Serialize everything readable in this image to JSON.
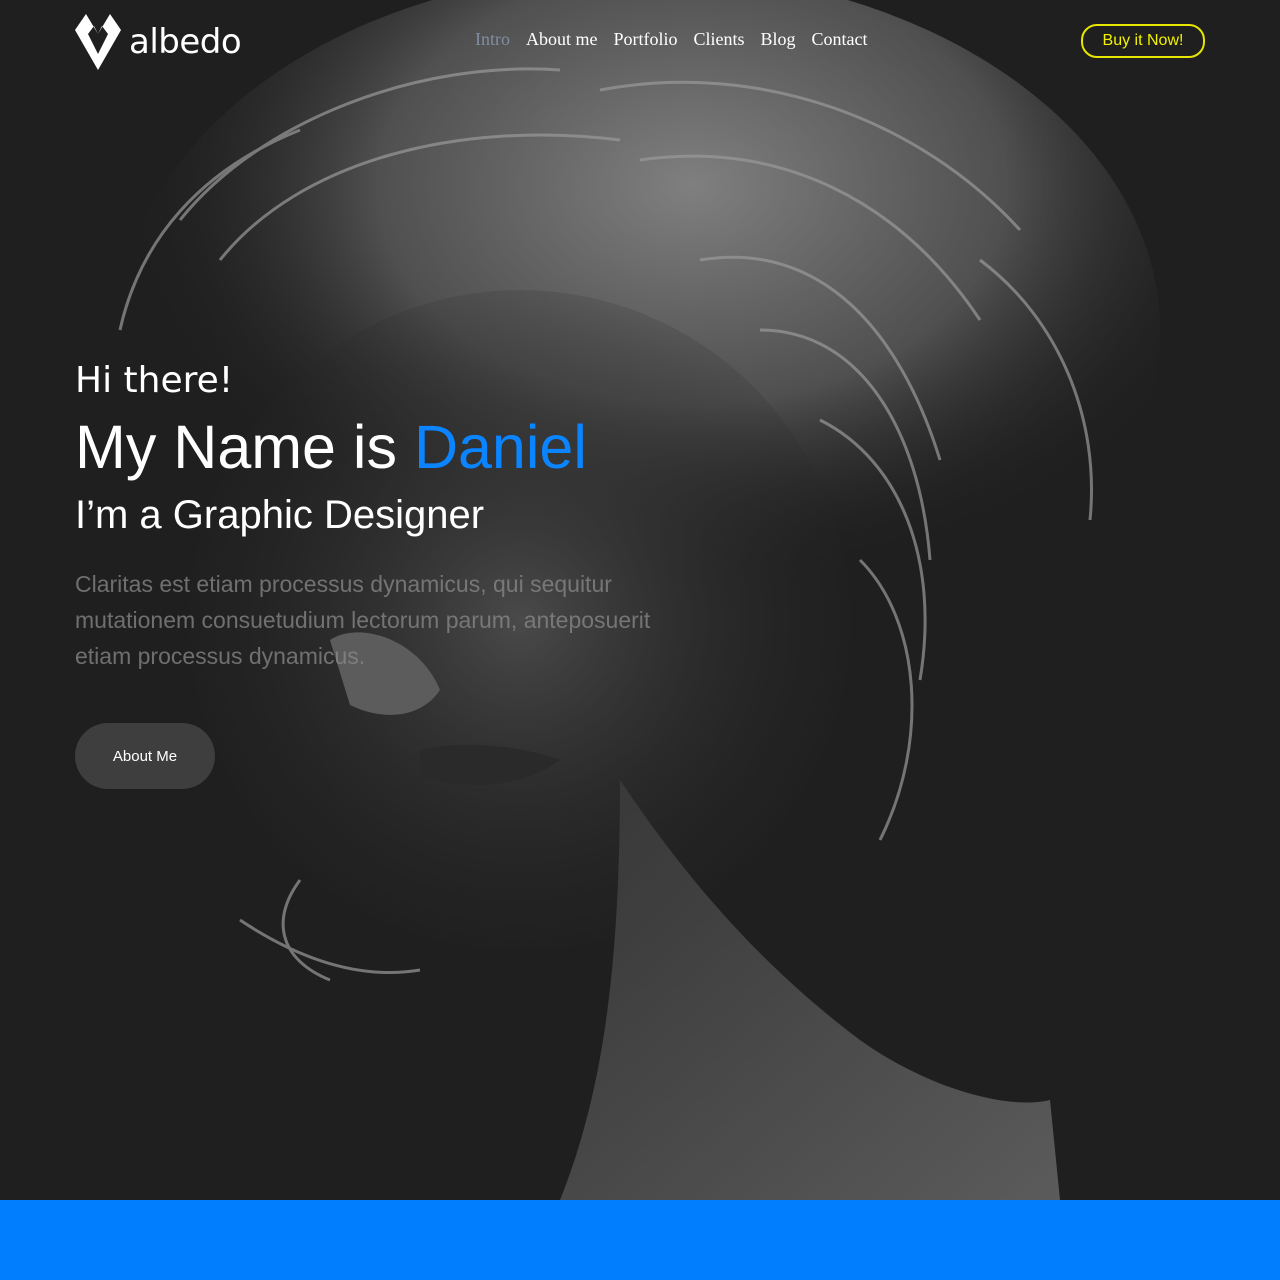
{
  "brand": {
    "name": "albedo",
    "icon": "albedo-logo-icon"
  },
  "nav": {
    "items": [
      {
        "label": "Intro",
        "active": true
      },
      {
        "label": "About me"
      },
      {
        "label": "Portfolio"
      },
      {
        "label": "Clients"
      },
      {
        "label": "Blog"
      },
      {
        "label": "Contact"
      }
    ]
  },
  "header": {
    "cta_label": "Buy it Now!"
  },
  "hero": {
    "greeting": "Hi there!",
    "headline_prefix": "My Name is ",
    "headline_name": "Daniel",
    "subhead": "I’m a Graphic Designer",
    "intro": "Claritas est etiam processus dynamicus, qui sequitur mutationem consuetudium lectorum parum, anteposuerit etiam processus dynamicus.",
    "button_label": "About Me"
  },
  "colors": {
    "accent": "#0a84ff",
    "cta": "#f2f200",
    "band": "#007efe",
    "background": "#202020"
  }
}
